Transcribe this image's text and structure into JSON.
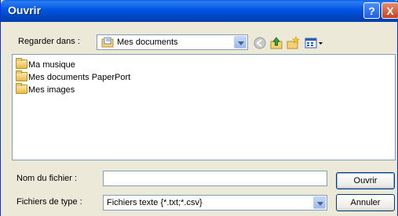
{
  "window": {
    "title": "Ouvrir",
    "help_label": "?",
    "close_label": "X"
  },
  "lookin": {
    "label": "Regarder dans :",
    "value": "Mes documents"
  },
  "toolbar": {
    "icons": [
      "back-icon",
      "up-folder-icon",
      "new-folder-icon",
      "view-menu-icon"
    ]
  },
  "files": [
    {
      "name": "Ma musique"
    },
    {
      "name": "Mes documents PaperPort"
    },
    {
      "name": "Mes images"
    }
  ],
  "filename": {
    "label": "Nom du fichier :",
    "value": ""
  },
  "filetype": {
    "label": "Fichiers de type :",
    "value": "Fichiers texte {*.txt;*.csv}"
  },
  "buttons": {
    "open": "Ouvrir",
    "cancel": "Annuler"
  }
}
